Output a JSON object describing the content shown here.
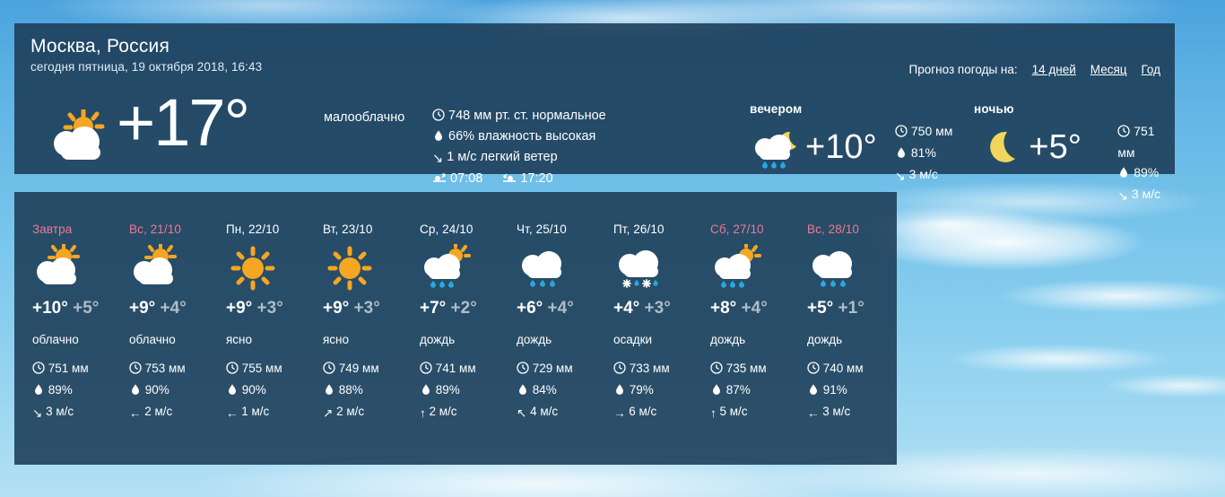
{
  "header": {
    "city": "Москва, Россия",
    "datetime": "сегодня пятница, 19 октября 2018, 16:43",
    "nav_label": "Прогноз погоды на:",
    "nav_links": [
      {
        "label": "14 дней"
      },
      {
        "label": "Месяц"
      },
      {
        "label": "Год"
      }
    ]
  },
  "current": {
    "icon": "partly-cloudy-sun-icon",
    "temp": "+17°",
    "description": "малооблачно",
    "pressure": "748 мм рт. ст. нормальное",
    "humidity": "66% влажность высокая",
    "wind": "1 м/с легкий ветер",
    "wind_dir": "↘",
    "sunrise": "07:08",
    "sunset": "17:20"
  },
  "parts": [
    {
      "label": "вечером",
      "icon": "cloud-rain-moon-icon",
      "temp": "+10°",
      "pressure": "750 мм",
      "humidity": "81%",
      "wind": "3 м/с",
      "wind_dir": "↘"
    },
    {
      "label": "ночью",
      "icon": "moon-icon",
      "temp": "+5°",
      "pressure": "751 мм",
      "humidity": "89%",
      "wind": "3 м/с",
      "wind_dir": "↘"
    }
  ],
  "forecast": [
    {
      "label": "Завтра",
      "weekend": true,
      "icon": "sun-cloud-icon",
      "high": "+10°",
      "low": "+5°",
      "description": "облачно",
      "pressure": "751 мм",
      "humidity": "89%",
      "wind": "3 м/с",
      "wind_dir": "↘"
    },
    {
      "label": "Вс, 21/10",
      "weekend": true,
      "icon": "sun-cloud-icon",
      "high": "+9°",
      "low": "+4°",
      "description": "облачно",
      "pressure": "753 мм",
      "humidity": "90%",
      "wind": "2 м/с",
      "wind_dir": "←"
    },
    {
      "label": "Пн, 22/10",
      "weekend": false,
      "icon": "sun-icon",
      "high": "+9°",
      "low": "+3°",
      "description": "ясно",
      "pressure": "755 мм",
      "humidity": "90%",
      "wind": "1 м/с",
      "wind_dir": "←"
    },
    {
      "label": "Вт, 23/10",
      "weekend": false,
      "icon": "sun-icon",
      "high": "+9°",
      "low": "+3°",
      "description": "ясно",
      "pressure": "749 мм",
      "humidity": "88%",
      "wind": "2 м/с",
      "wind_dir": "↗"
    },
    {
      "label": "Ср, 24/10",
      "weekend": false,
      "icon": "sun-cloud-rain-icon",
      "high": "+7°",
      "low": "+2°",
      "description": "дождь",
      "pressure": "741 мм",
      "humidity": "89%",
      "wind": "2 м/с",
      "wind_dir": "↑"
    },
    {
      "label": "Чт, 25/10",
      "weekend": false,
      "icon": "cloud-rain-icon",
      "high": "+6°",
      "low": "+4°",
      "description": "дождь",
      "pressure": "729 мм",
      "humidity": "84%",
      "wind": "4 м/с",
      "wind_dir": "↖"
    },
    {
      "label": "Пт, 26/10",
      "weekend": false,
      "icon": "cloud-sleet-icon",
      "high": "+4°",
      "low": "+3°",
      "description": "осадки",
      "pressure": "733 мм",
      "humidity": "79%",
      "wind": "6 м/с",
      "wind_dir": "→"
    },
    {
      "label": "Сб, 27/10",
      "weekend": true,
      "icon": "sun-cloud-rain-icon",
      "high": "+8°",
      "low": "+4°",
      "description": "дождь",
      "pressure": "735 мм",
      "humidity": "87%",
      "wind": "5 м/с",
      "wind_dir": "↑"
    },
    {
      "label": "Вс, 28/10",
      "weekend": true,
      "icon": "cloud-rain-icon",
      "high": "+5°",
      "low": "+1°",
      "description": "дождь",
      "pressure": "740 мм",
      "humidity": "91%",
      "wind": "3 м/с",
      "wind_dir": "←"
    }
  ],
  "colors": {
    "panel": "#1b3b55",
    "weekend": "#f2788f",
    "sun": "#f5a623",
    "rain": "#29a8e0",
    "low_temp": "#aebdc8"
  }
}
